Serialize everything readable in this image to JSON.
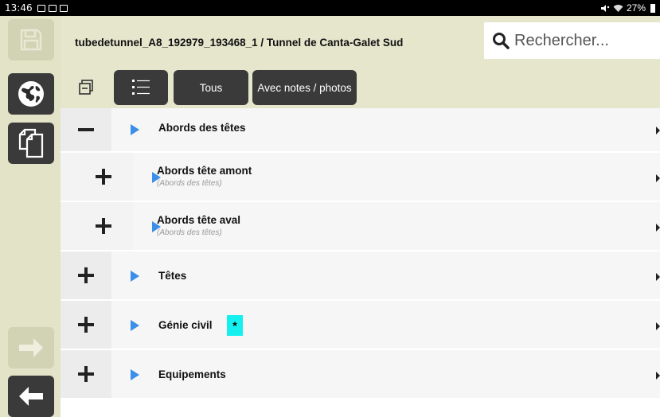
{
  "status_bar": {
    "time": "13:46",
    "battery": "27%"
  },
  "header": {
    "title": "tubedetunnel_A8_192979_193468_1 / Tunnel de Canta-Galet Sud",
    "search_placeholder": "Rechercher..."
  },
  "toolbar": {
    "filter_all": "Tous",
    "filter_notes": "Avec notes / photos"
  },
  "sidebar": {
    "save": "save-icon",
    "globe": "globe-icon",
    "copy": "copy-icon",
    "forward": "arrow-right-icon",
    "back": "arrow-left-icon"
  },
  "rows": [
    {
      "label": "Abords des têtes",
      "sublabel": "",
      "toggle": "−",
      "level": 0
    },
    {
      "label": "Abords tête amont",
      "sublabel": "(Abords des têtes)",
      "toggle": "+",
      "level": 1
    },
    {
      "label": "Abords tête aval",
      "sublabel": "(Abords des têtes)",
      "toggle": "+",
      "level": 1
    },
    {
      "label": "Têtes",
      "sublabel": "",
      "toggle": "+",
      "level": 0
    },
    {
      "label": "Génie civil",
      "sublabel": "",
      "toggle": "+",
      "level": 0,
      "badge": "*"
    },
    {
      "label": "Equipements",
      "sublabel": "",
      "toggle": "+",
      "level": 0
    }
  ],
  "colors": {
    "accent_play": "#3b8fe8",
    "badge": "#14f0f0",
    "dark_button": "#3a3a3a",
    "sidebar_bg": "#e3e3c8"
  }
}
